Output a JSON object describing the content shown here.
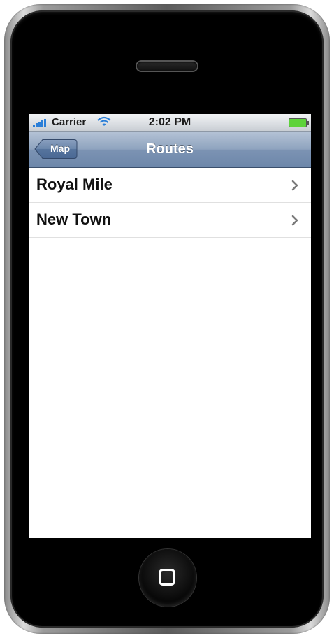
{
  "status_bar": {
    "carrier": "Carrier",
    "time": "2:02 PM",
    "signal_icon": "signal-bars-icon",
    "wifi_icon": "wifi-icon",
    "battery_icon": "battery-icon",
    "battery_color": "#5ed33b"
  },
  "nav_bar": {
    "back_label": "Map",
    "title": "Routes"
  },
  "routes": {
    "items": [
      {
        "label": "Royal Mile"
      },
      {
        "label": "New Town"
      }
    ]
  },
  "colors": {
    "nav_bar": "#7c93b3",
    "signal": "#2b7fd8"
  }
}
